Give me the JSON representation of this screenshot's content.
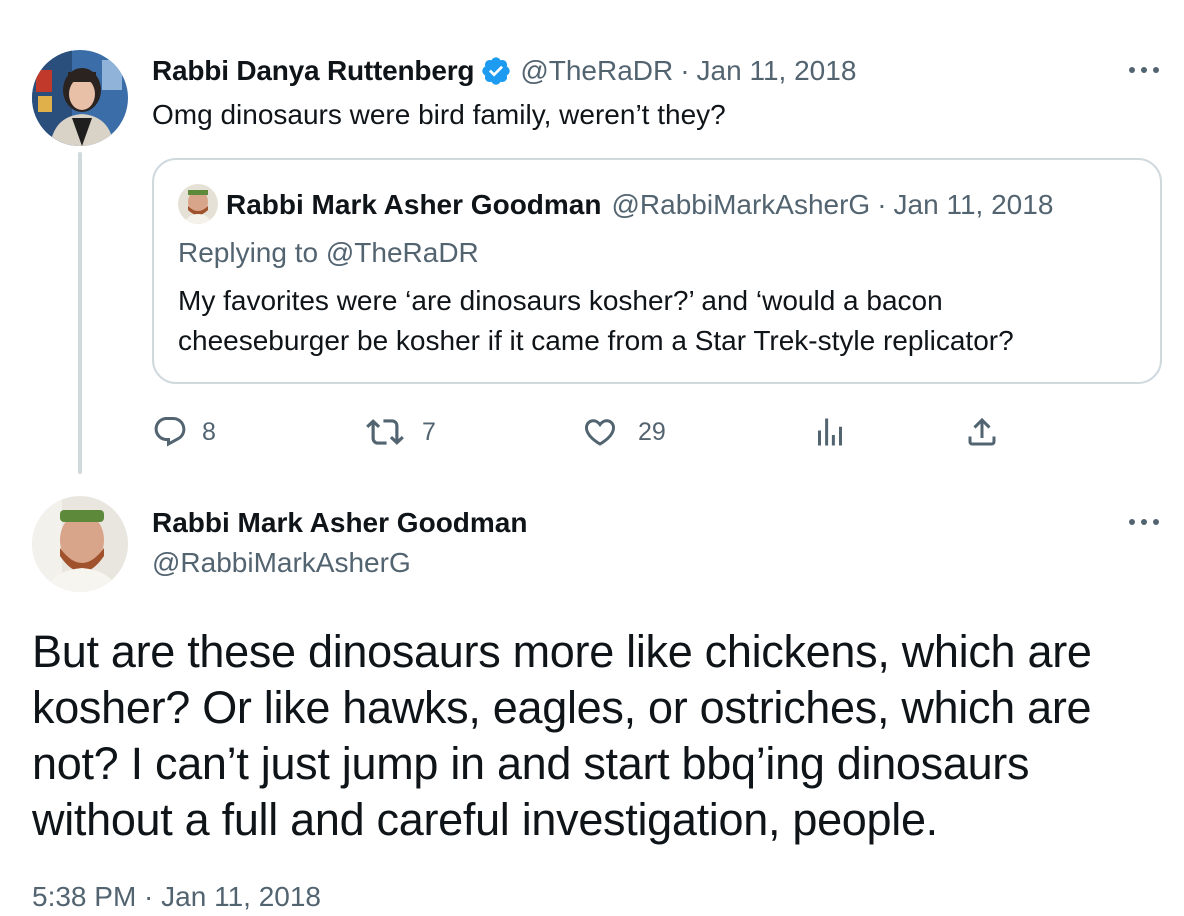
{
  "first_tweet": {
    "author_name": "Rabbi Danya Ruttenberg",
    "handle": "@TheRaDR",
    "separator": "·",
    "date": "Jan 11, 2018",
    "text": "Omg dinosaurs were bird family, weren’t they?",
    "verified_badge_icon": "verified-badge-icon",
    "more_icon": "more-horizontal-icon",
    "quoted_tweet": {
      "author_name": "Rabbi Mark Asher Goodman",
      "handle": "@RabbiMarkAsherG",
      "separator": "·",
      "date": "Jan 11, 2018",
      "replying_to_prefix": "Replying to",
      "replying_to_handle": "@TheRaDR",
      "text_line1": "My favorites were ‘are dinosaurs kosher?’ and ‘would a bacon",
      "text_line2": "cheeseburger be kosher if it came from a Star Trek-style replicator?"
    },
    "actions": {
      "replies": "8",
      "retweets": "7",
      "likes": "29",
      "reply_icon": "reply-icon",
      "retweet_icon": "retweet-icon",
      "like_icon": "heart-icon",
      "views_icon": "bar-chart-icon",
      "share_icon": "share-icon"
    }
  },
  "main_tweet": {
    "author_name": "Rabbi Mark Asher Goodman",
    "handle": "@RabbiMarkAsherG",
    "more_icon": "more-horizontal-icon",
    "text_line1": "But are these dinosaurs more like chickens, which are",
    "text_line2": "kosher? Or like hawks, eagles, or ostriches, which are",
    "text_line3": "not? I can’t just jump in and start bbq’ing dinosaurs",
    "text_line4": "without a full and careful investigation, people.",
    "timestamp": "5:38 PM · Jan 11, 2018"
  },
  "colors": {
    "text": "#0f1419",
    "muted": "#536471",
    "verified_blue": "#1d9bf0",
    "border": "#cfd9de"
  }
}
